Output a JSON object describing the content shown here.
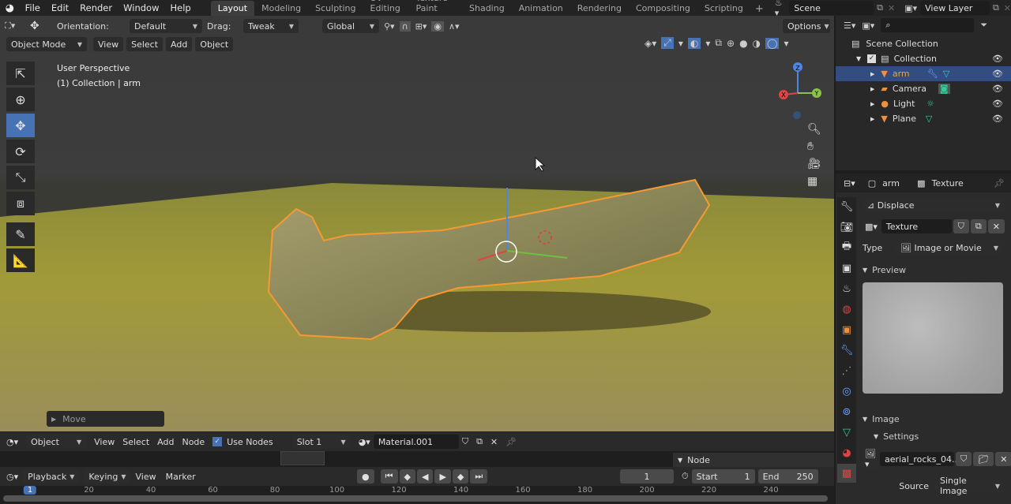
{
  "topbar": {
    "menus": [
      "File",
      "Edit",
      "Render",
      "Window",
      "Help"
    ],
    "workspaces": [
      "Layout",
      "Modeling",
      "Sculpting",
      "UV Editing",
      "Texture Paint",
      "Shading",
      "Animation",
      "Rendering",
      "Compositing",
      "Scripting"
    ],
    "active_workspace": "Layout",
    "add": "+",
    "scene": "Scene",
    "view_layer": "View Layer"
  },
  "tool_settings": {
    "orientation_label": "Orientation:",
    "orientation": "Default",
    "drag_label": "Drag:",
    "drag": "Tweak",
    "transform": "Global",
    "options": "Options"
  },
  "viewport_header": {
    "mode": "Object Mode",
    "menus": [
      "View",
      "Select",
      "Add",
      "Object"
    ]
  },
  "viewport": {
    "perspective": "User Perspective",
    "collection": "(1) Collection | arm",
    "operator_panel": "Move",
    "gizmo": {
      "x": "X",
      "y": "Y",
      "z": "Z"
    },
    "accent": "#4772b3",
    "selection_outline": "#f59a32"
  },
  "toolbar": {
    "tools": [
      "select-box-icon",
      "cursor-icon",
      "move-icon",
      "rotate-icon",
      "scale-icon",
      "transform-icon",
      "annotate-icon",
      "measure-icon"
    ],
    "active": "move-icon"
  },
  "outliner": {
    "root": "Scene Collection",
    "items": [
      {
        "name": "Collection",
        "level": 1
      },
      {
        "name": "arm",
        "level": 2,
        "selected": true
      },
      {
        "name": "Camera",
        "level": 2
      },
      {
        "name": "Light",
        "level": 2
      },
      {
        "name": "Plane",
        "level": 2
      }
    ]
  },
  "properties": {
    "object": "arm",
    "context": "Texture",
    "modifier": "Displace",
    "texture_name": "Texture",
    "type_label": "Type",
    "type": "Image or Movie",
    "preview_label": "Preview",
    "image_label": "Image",
    "settings_label": "Settings",
    "image_name": "aerial_rocks_04...",
    "source_label": "Source",
    "source": "Single Image"
  },
  "shader_editor": {
    "type": "Object",
    "menus": [
      "View",
      "Select",
      "Add",
      "Node"
    ],
    "use_nodes": "Use Nodes",
    "use_nodes_checked": true,
    "slot": "Slot 1",
    "material": "Material.001",
    "node_panel": "Node"
  },
  "timeline": {
    "menus": [
      "Playback",
      "Keying",
      "View",
      "Marker"
    ],
    "current_frame": "1",
    "start_label": "Start",
    "start": "1",
    "end_label": "End",
    "end": "250",
    "ticks": [
      "1",
      "20",
      "40",
      "60",
      "80",
      "100",
      "120",
      "140",
      "160",
      "180",
      "200",
      "220",
      "240"
    ]
  }
}
